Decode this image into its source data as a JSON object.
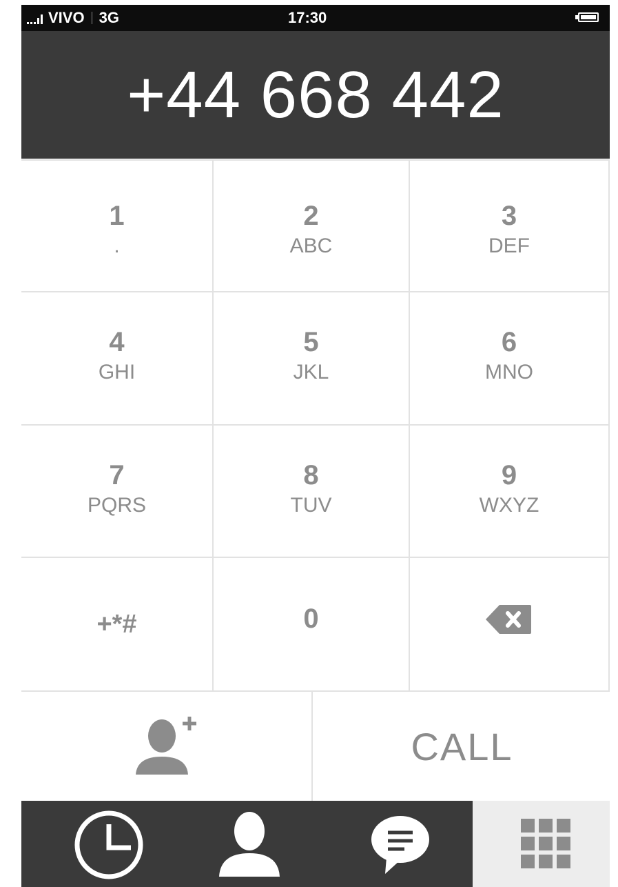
{
  "status_bar": {
    "carrier": "VIVO",
    "network": "3G",
    "time": "17:30"
  },
  "display": {
    "number": "+44 668 442"
  },
  "keypad": {
    "keys": [
      {
        "digit": "1",
        "letters": "."
      },
      {
        "digit": "2",
        "letters": "ABC"
      },
      {
        "digit": "3",
        "letters": "DEF"
      },
      {
        "digit": "4",
        "letters": "GHI"
      },
      {
        "digit": "5",
        "letters": "JKL"
      },
      {
        "digit": "6",
        "letters": "MNO"
      },
      {
        "digit": "7",
        "letters": "PQRS"
      },
      {
        "digit": "8",
        "letters": "TUV"
      },
      {
        "digit": "9",
        "letters": "WXYZ"
      },
      {
        "digit": "+*#"
      },
      {
        "digit": "0"
      }
    ],
    "backspace_icon": "backspace-icon"
  },
  "actions": {
    "add_contact_icon": "add-contact-icon",
    "call_label": "CALL"
  },
  "tabbar": {
    "tabs": [
      {
        "icon": "recents-clock-icon"
      },
      {
        "icon": "contacts-person-icon"
      },
      {
        "icon": "messages-chat-icon"
      },
      {
        "icon": "keypad-grid-icon",
        "active": true
      }
    ]
  },
  "colors": {
    "dark": "#3a3a3a",
    "status_bar": "#0d0d0d",
    "key_text": "#8c8c8c",
    "divider": "#e2e2e2",
    "active_tab": "#ededed"
  }
}
